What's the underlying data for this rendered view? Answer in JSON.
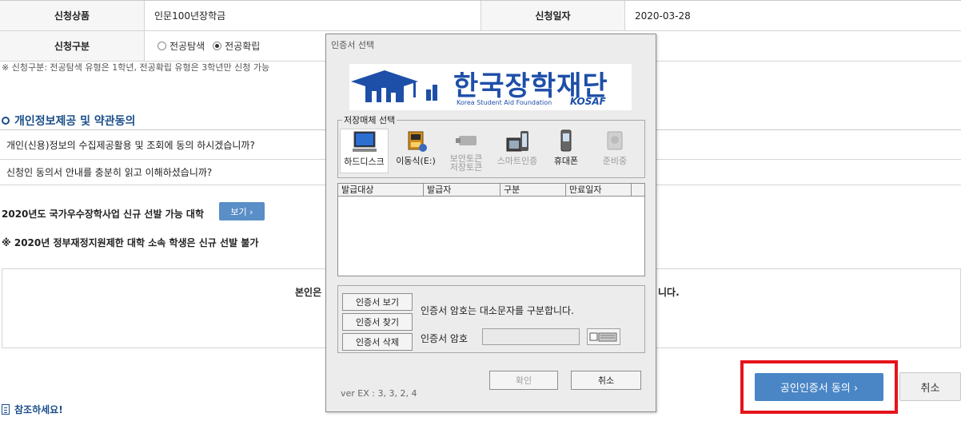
{
  "form": {
    "product_label": "신청상품",
    "product_value": "인문100년장학금",
    "date_label": "신청일자",
    "date_value": "2020-03-28",
    "type_label": "신청구분",
    "type_option1": "전공탐색",
    "type_option2": "전공확립",
    "type_note": "※ 신청구분: 전공탐색 유형은 1학년, 전공확립 유형은 3학년만 신청 가능"
  },
  "privacy": {
    "title": "개인정보제공 및 약관동의",
    "q1": "개인(신용)정보의 수집제공활용 및 조회에 동의 하시겠습니까?",
    "q2": "신청인 동의서 안내를 충분히 읽고 이해하셨습니까?"
  },
  "univ": {
    "text": "2020년도 국가우수장학사업 신규 선발 가능 대학",
    "view_button": "보기 ›",
    "restriction": "※ 2020년 정부재정지원제한 대학 소속 학생은 신규 선발 불가"
  },
  "notice": {
    "left_text": "본인은",
    "right_text": "니다."
  },
  "actions": {
    "cert_agree": "공인인증서 동의  ›",
    "cancel": "취소"
  },
  "reference": "참조하세요!",
  "dialog": {
    "title": "인증서 선택",
    "logo_ko": "한국장학재단",
    "logo_en": "Korea Student Aid Foundation",
    "logo_abbr": "KOSAF",
    "media_legend": "저장매체 선택",
    "media": [
      {
        "label": "하드디스크"
      },
      {
        "label": "이동식(E:)"
      },
      {
        "label": "보안토큰\n저장토큰"
      },
      {
        "label": "스마트인증"
      },
      {
        "label": "휴대폰"
      },
      {
        "label": "준비중"
      }
    ],
    "columns": [
      "발급대상",
      "발급자",
      "구분",
      "만료일자"
    ],
    "btn_view": "인증서 보기",
    "btn_find": "인증서 찾기",
    "btn_delete": "인증서 삭제",
    "case_note": "인증서 암호는 대소문자를 구분합니다.",
    "password_label": "인증서 암호",
    "confirm": "확인",
    "cancel": "취소",
    "version": "ver EX : 3, 3, 2, 4"
  },
  "colors": {
    "accent_blue": "#4a86c6",
    "title_blue": "#1a4e8a",
    "highlight_red": "#e5141b",
    "logo_blue": "#1e4fa8"
  }
}
